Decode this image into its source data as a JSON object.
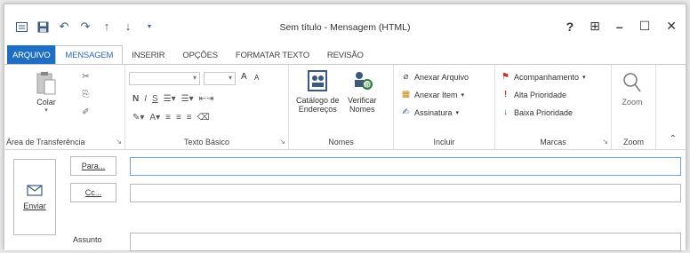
{
  "window": {
    "title": "Sem título - Mensagem (HTML)",
    "help": "?",
    "minimize": "–",
    "maximize": "☐",
    "close": "✕",
    "ribbon_options": "⊞"
  },
  "qat": {
    "icons": [
      "mail-icon",
      "save-icon",
      "undo-icon",
      "redo-icon",
      "up-arrow-icon",
      "down-arrow-icon",
      "customize-icon"
    ]
  },
  "tabs": {
    "file": "ARQUIVO",
    "message": "MENSAGEM",
    "insert": "INSERIR",
    "options": "OPÇÕES",
    "format": "FORMATAR TEXTO",
    "review": "REVISÃO"
  },
  "ribbon": {
    "clipboard": {
      "label": "Área de Transferência",
      "paste": "Colar"
    },
    "basic_text": {
      "label": "Texto Básico",
      "bold": "N",
      "italic": "I",
      "underline": "S",
      "grow": "A",
      "shrink": "A"
    },
    "names": {
      "label": "Nomes",
      "address_book_1": "Catálogo de",
      "address_book_2": "Endereços",
      "check_1": "Verificar",
      "check_2": "Nomes"
    },
    "include": {
      "label": "Incluir",
      "attach_file": "Anexar Arquivo",
      "attach_item": "Anexar Item",
      "signature": "Assinatura"
    },
    "tags": {
      "label": "Marcas",
      "followup": "Acompanhamento",
      "high": "Alta Prioridade",
      "low": "Baixa Prioridade"
    },
    "zoom": {
      "label": "Zoom",
      "button": "Zoom"
    }
  },
  "compose": {
    "send": "Enviar",
    "to": "Para...",
    "cc": "Cc...",
    "subject": "Assunto",
    "to_value": "",
    "cc_value": "",
    "subject_value": ""
  },
  "colors": {
    "accent": "#1e6fc3",
    "flag": "#c0392b",
    "focus": "#6fa1d6"
  }
}
